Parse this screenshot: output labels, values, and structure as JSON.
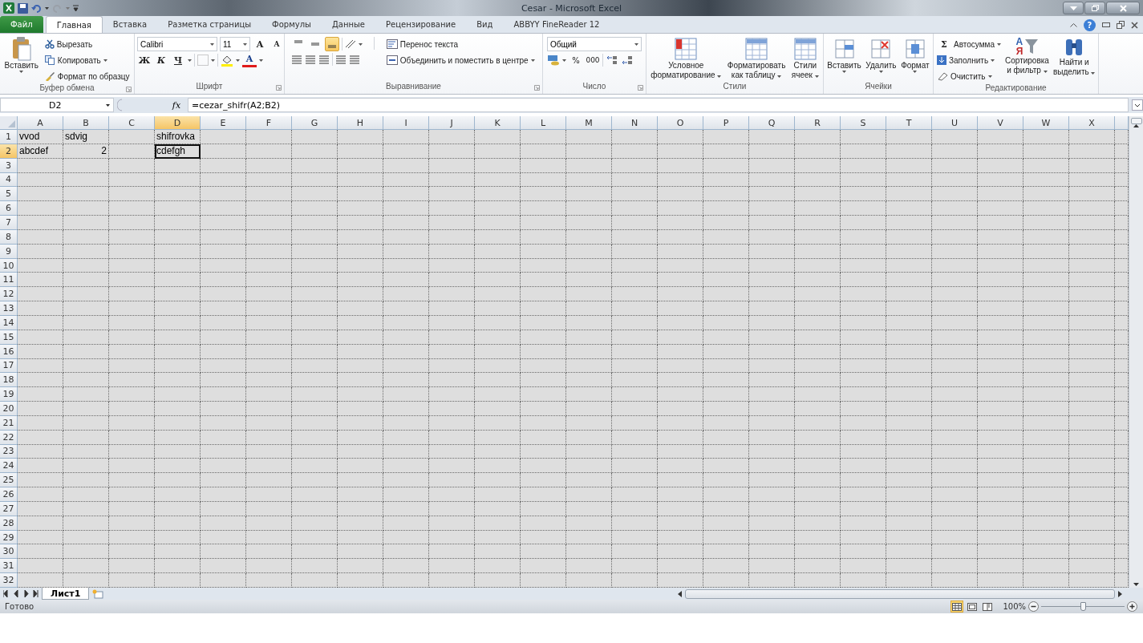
{
  "window": {
    "title": "Cesar - Microsoft Excel",
    "help": "?"
  },
  "ribbon_tabs": [
    {
      "label": "Файл",
      "kind": "file",
      "selected": false
    },
    {
      "label": "Главная",
      "kind": "tab",
      "selected": true
    },
    {
      "label": "Вставка",
      "kind": "tab",
      "selected": false
    },
    {
      "label": "Разметка страницы",
      "kind": "tab",
      "selected": false
    },
    {
      "label": "Формулы",
      "kind": "tab",
      "selected": false
    },
    {
      "label": "Данные",
      "kind": "tab",
      "selected": false
    },
    {
      "label": "Рецензирование",
      "kind": "tab",
      "selected": false
    },
    {
      "label": "Вид",
      "kind": "tab",
      "selected": false
    },
    {
      "label": "ABBYY FineReader 12",
      "kind": "tab",
      "selected": false
    }
  ],
  "clipboard": {
    "title": "Буфер обмена",
    "paste": "Вставить",
    "commands": [
      {
        "label": "Вырезать",
        "dropdown": false
      },
      {
        "label": "Копировать",
        "dropdown": true
      },
      {
        "label": "Формат по образцу",
        "dropdown": false
      }
    ]
  },
  "font": {
    "title": "Шрифт",
    "name": "Calibri",
    "size": "11",
    "grow": "A",
    "shrink": "A",
    "bold": "Ж",
    "italic": "К",
    "underline": "Ч",
    "color_letter": "A"
  },
  "alignment": {
    "title": "Выравнивание",
    "vertical": [
      {
        "selected": false
      },
      {
        "selected": false
      },
      {
        "selected": true
      }
    ],
    "wrap": "Перенос текста",
    "merge": "Объединить и поместить в центре"
  },
  "number": {
    "title": "Число",
    "format": "Общий",
    "percent": "%",
    "thousands": "000"
  },
  "styles": {
    "title": "Стили",
    "buttons": [
      {
        "lines": [
          "Условное",
          "форматирование"
        ]
      },
      {
        "lines": [
          "Форматировать",
          "как таблицу"
        ]
      },
      {
        "lines": [
          "Стили",
          "ячеек"
        ]
      }
    ]
  },
  "cells": {
    "title": "Ячейки",
    "buttons": [
      "Вставить",
      "Удалить",
      "Формат"
    ]
  },
  "editing": {
    "title": "Редактирование",
    "sigma": "Σ",
    "commands": [
      "Автосумма",
      "Заполнить",
      "Очистить"
    ],
    "sort": {
      "lines": [
        "Сортировка",
        "и фильтр"
      ],
      "letters": [
        "А",
        "Я"
      ]
    },
    "find": {
      "lines": [
        "Найти и",
        "выделить"
      ]
    }
  },
  "formula_bar": {
    "name_box": "D2",
    "fx": "fx",
    "formula": "=cezar_shifr(A2;B2)"
  },
  "grid": {
    "columns": [
      {
        "label": "A",
        "selected": false
      },
      {
        "label": "B",
        "selected": false
      },
      {
        "label": "C",
        "selected": false
      },
      {
        "label": "D",
        "selected": true
      },
      {
        "label": "E",
        "selected": false
      },
      {
        "label": "F",
        "selected": false
      },
      {
        "label": "G",
        "selected": false
      },
      {
        "label": "H",
        "selected": false
      },
      {
        "label": "I",
        "selected": false
      },
      {
        "label": "J",
        "selected": false
      },
      {
        "label": "K",
        "selected": false
      },
      {
        "label": "L",
        "selected": false
      },
      {
        "label": "M",
        "selected": false
      },
      {
        "label": "N",
        "selected": false
      },
      {
        "label": "O",
        "selected": false
      },
      {
        "label": "P",
        "selected": false
      },
      {
        "label": "Q",
        "selected": false
      },
      {
        "label": "R",
        "selected": false
      },
      {
        "label": "S",
        "selected": false
      },
      {
        "label": "T",
        "selected": false
      },
      {
        "label": "U",
        "selected": false
      },
      {
        "label": "V",
        "selected": false
      },
      {
        "label": "W",
        "selected": false
      },
      {
        "label": "X",
        "selected": false
      }
    ],
    "rows": [
      {
        "label": "1",
        "selected": false,
        "cells": [
          {
            "text": "vvod",
            "kind": "text",
            "selected": false
          },
          {
            "text": "sdvig",
            "kind": "text",
            "selected": false
          },
          {
            "kind": "text",
            "selected": false
          },
          {
            "text": "shifrovka",
            "kind": "text",
            "selected": false
          }
        ]
      },
      {
        "label": "2",
        "selected": true,
        "cells": [
          {
            "text": "abcdef",
            "kind": "text",
            "selected": false
          },
          {
            "text": "2",
            "kind": "number",
            "selected": false
          },
          {
            "kind": "text",
            "selected": false
          },
          {
            "text": "cdefgh",
            "kind": "text",
            "selected": true
          }
        ]
      },
      {
        "label": "3",
        "selected": false
      },
      {
        "label": "4",
        "selected": false
      },
      {
        "label": "5",
        "selected": false
      },
      {
        "label": "6",
        "selected": false
      },
      {
        "label": "7",
        "selected": false
      },
      {
        "label": "8",
        "selected": false
      },
      {
        "label": "9",
        "selected": false
      },
      {
        "label": "10",
        "selected": false
      },
      {
        "label": "11",
        "selected": false
      },
      {
        "label": "12",
        "selected": false
      },
      {
        "label": "13",
        "selected": false
      },
      {
        "label": "14",
        "selected": false
      },
      {
        "label": "15",
        "selected": false
      },
      {
        "label": "16",
        "selected": false
      },
      {
        "label": "17",
        "selected": false
      },
      {
        "label": "18",
        "selected": false
      },
      {
        "label": "19",
        "selected": false
      },
      {
        "label": "20",
        "selected": false
      },
      {
        "label": "21",
        "selected": false
      },
      {
        "label": "22",
        "selected": false
      },
      {
        "label": "23",
        "selected": false
      },
      {
        "label": "24",
        "selected": false
      },
      {
        "label": "25",
        "selected": false
      },
      {
        "label": "26",
        "selected": false
      },
      {
        "label": "27",
        "selected": false
      },
      {
        "label": "28",
        "selected": false
      },
      {
        "label": "29",
        "selected": false
      },
      {
        "label": "30",
        "selected": false
      },
      {
        "label": "31",
        "selected": false
      },
      {
        "label": "32",
        "selected": false
      }
    ]
  },
  "sheets": [
    {
      "label": "Лист1",
      "selected": true
    }
  ],
  "status_bar": {
    "text": "Готово",
    "views": [
      {
        "selected": true
      },
      {
        "selected": false
      },
      {
        "selected": false
      }
    ],
    "zoom": "100%",
    "zoom_slider": {
      "level": 0.5
    }
  }
}
